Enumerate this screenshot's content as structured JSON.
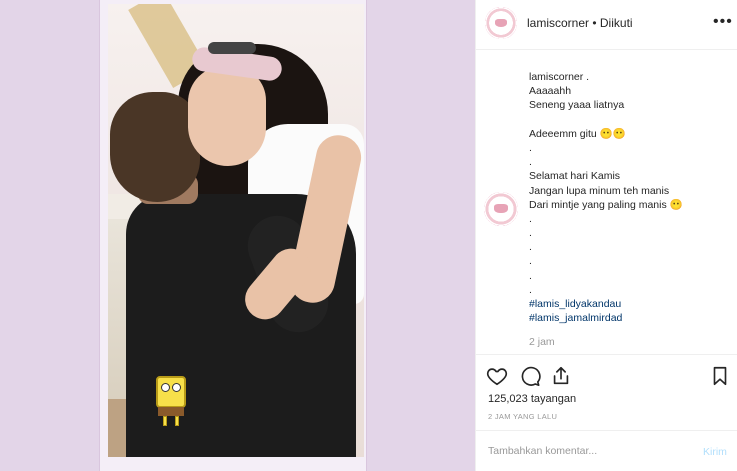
{
  "header": {
    "username": "lamiscorner",
    "separator": " • ",
    "follow_status": "Diikuti",
    "more_icon": "more-horizontal-icon"
  },
  "caption": {
    "lines": [
      "lamiscorner .",
      "Aaaaahh",
      "Seneng yaaa liatnya",
      "",
      "Adeeemm gitu 😶😶",
      ".",
      ".",
      "Selamat hari Kamis",
      "Jangan lupa minum teh manis",
      "Dari mintje yang paling manis 😶",
      ".",
      ".",
      ".",
      ".",
      ".",
      ".",
      "#lamis_lidyakandau",
      "#lamis_jamalmirdad"
    ],
    "time": "2 jam"
  },
  "actions": {
    "like_icon": "heart-icon",
    "comment_icon": "comment-icon",
    "share_icon": "share-icon",
    "save_icon": "bookmark-icon",
    "views": "125,023 tayangan",
    "timestamp": "2 JAM YANG LALU"
  },
  "comment": {
    "placeholder": "Tambahkan komentar...",
    "send_label": "Kirim"
  },
  "colors": {
    "background": "#e3d5e8",
    "hashtag": "#003569",
    "muted": "#999999",
    "send_disabled": "#b2dffc",
    "avatar_ring": "#d9467f"
  }
}
